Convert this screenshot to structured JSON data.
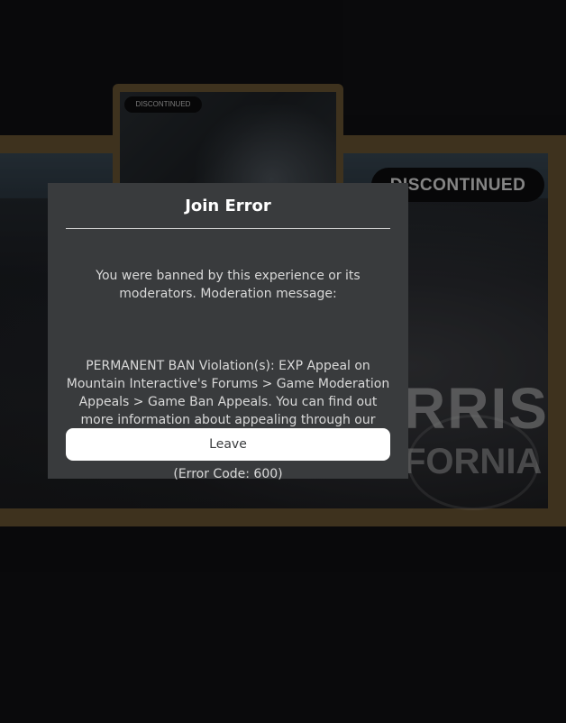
{
  "background": {
    "thumbnail_badge": "DISCONTINUED",
    "banner_badge": "DISCONTINUED",
    "banner_text_line1": "RRIS",
    "banner_text_line2": "FORNIA"
  },
  "dialog": {
    "title": "Join Error",
    "message_line1": "You were banned by this experience or its moderators. Moderation message:",
    "message_line2": "PERMANENT BAN Violation(s): EXP Appeal on Mountain Interactive's Forums > Game Moderation Appeals > Game Ban Appeals. You can find out more information about appealing through our communications server.",
    "error_code": "(Error Code: 600)",
    "leave_label": "Leave"
  },
  "colors": {
    "modal_background": "#393b3d",
    "button_background": "#ffffff",
    "frame_accent": "#6b5634"
  }
}
